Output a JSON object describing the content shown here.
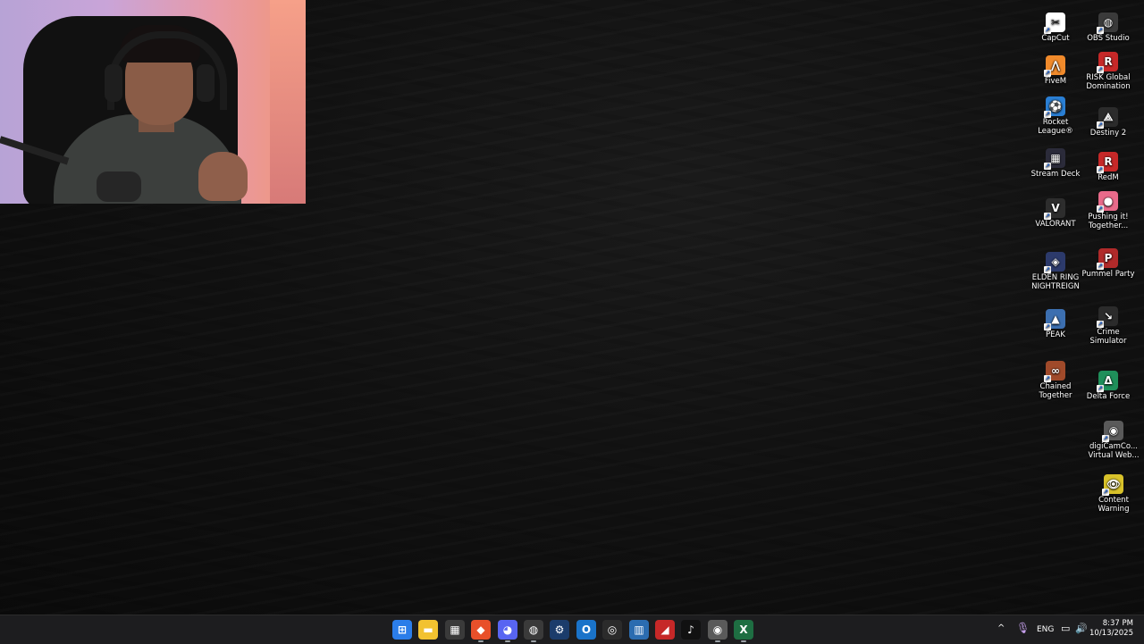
{
  "desktop": {
    "icons_col1": [
      {
        "label": "CapCut",
        "icon": "capcut-icon",
        "color": "#ffffff",
        "glyph": "✂"
      },
      {
        "label": "FiveM",
        "icon": "fivem-icon",
        "color": "#f08a2b",
        "glyph": "⋀"
      },
      {
        "label": "Rocket League®",
        "icon": "rocket-league-icon",
        "color": "#2a7fd4",
        "glyph": "⚽"
      },
      {
        "label": "Stream Deck",
        "icon": "stream-deck-icon",
        "color": "#2b2b3a",
        "glyph": "▦"
      },
      {
        "label": "VALORANT",
        "icon": "valorant-icon",
        "color": "#2d2d2d",
        "glyph": "V"
      },
      {
        "label": "ELDEN RING NIGHTREIGN",
        "icon": "elden-ring-icon",
        "color": "#2c3a6b",
        "glyph": "◈"
      },
      {
        "label": "PEAK",
        "icon": "peak-icon",
        "color": "#3c6fb0",
        "glyph": "▲"
      },
      {
        "label": "Chained Together",
        "icon": "chained-together-icon",
        "color": "#a04a2a",
        "glyph": "∞"
      }
    ],
    "icons_col2": [
      {
        "label": "OBS Studio",
        "icon": "obs-studio-icon",
        "color": "#3a3a3a",
        "glyph": "◍"
      },
      {
        "label": "RISK Global Domination",
        "icon": "risk-icon",
        "color": "#c62828",
        "glyph": "R"
      },
      {
        "label": "Destiny 2",
        "icon": "destiny-2-icon",
        "color": "#2b2b2b",
        "glyph": "⟁"
      },
      {
        "label": "RedM",
        "icon": "redm-icon",
        "color": "#c62828",
        "glyph": "R"
      },
      {
        "label": "Pushing it! Together...",
        "icon": "pushing-it-icon",
        "color": "#e86a8a",
        "glyph": "●"
      },
      {
        "label": "Pummel Party",
        "icon": "pummel-party-icon",
        "color": "#b02a2a",
        "glyph": "P"
      },
      {
        "label": "Crime Simulator",
        "icon": "crime-simulator-icon",
        "color": "#2b2b2b",
        "glyph": "↘"
      },
      {
        "label": "Delta Force",
        "icon": "delta-force-icon",
        "color": "#1f8f5a",
        "glyph": "Δ"
      },
      {
        "label": "digiCamCo... Virtual Web...",
        "icon": "digicam-icon",
        "color": "#5a5a5a",
        "glyph": "◉"
      },
      {
        "label": "Content Warning",
        "icon": "content-warning-icon",
        "color": "#d8c22a",
        "glyph": "👁"
      }
    ]
  },
  "taskbar": {
    "apps": [
      {
        "name": "start-button",
        "glyph": "⊞",
        "color": "#2b7de9",
        "active": false
      },
      {
        "name": "file-explorer-icon",
        "glyph": "▬",
        "color": "#f2c230",
        "active": false
      },
      {
        "name": "microsoft-store-icon",
        "glyph": "▦",
        "color": "#3a3a3a",
        "active": false
      },
      {
        "name": "brave-browser-icon",
        "glyph": "◆",
        "color": "#e8502a",
        "active": true
      },
      {
        "name": "discord-icon",
        "glyph": "◕",
        "color": "#5865f2",
        "active": true
      },
      {
        "name": "obs-taskbar-icon",
        "glyph": "◍",
        "color": "#3a3a3a",
        "active": true
      },
      {
        "name": "steam-icon",
        "glyph": "⚙",
        "color": "#1b3c6b",
        "active": false
      },
      {
        "name": "outlook-icon",
        "glyph": "O",
        "color": "#1a73c9",
        "active": false
      },
      {
        "name": "capture-tool-icon",
        "glyph": "◎",
        "color": "#2b2b2b",
        "active": false
      },
      {
        "name": "calendar-app-icon",
        "glyph": "▥",
        "color": "#2b6cb0",
        "active": false
      },
      {
        "name": "amd-software-icon",
        "glyph": "◢",
        "color": "#c62828",
        "active": false
      },
      {
        "name": "tiktok-icon",
        "glyph": "♪",
        "color": "#111111",
        "active": false
      },
      {
        "name": "webcam-app-icon",
        "glyph": "◉",
        "color": "#5a5a5a",
        "active": true
      },
      {
        "name": "excel-icon",
        "glyph": "X",
        "color": "#1e6e42",
        "active": true
      }
    ],
    "tray": {
      "chevron": "^",
      "language": "ENG",
      "time": "8:37 PM",
      "date": "10/13/2025"
    }
  }
}
